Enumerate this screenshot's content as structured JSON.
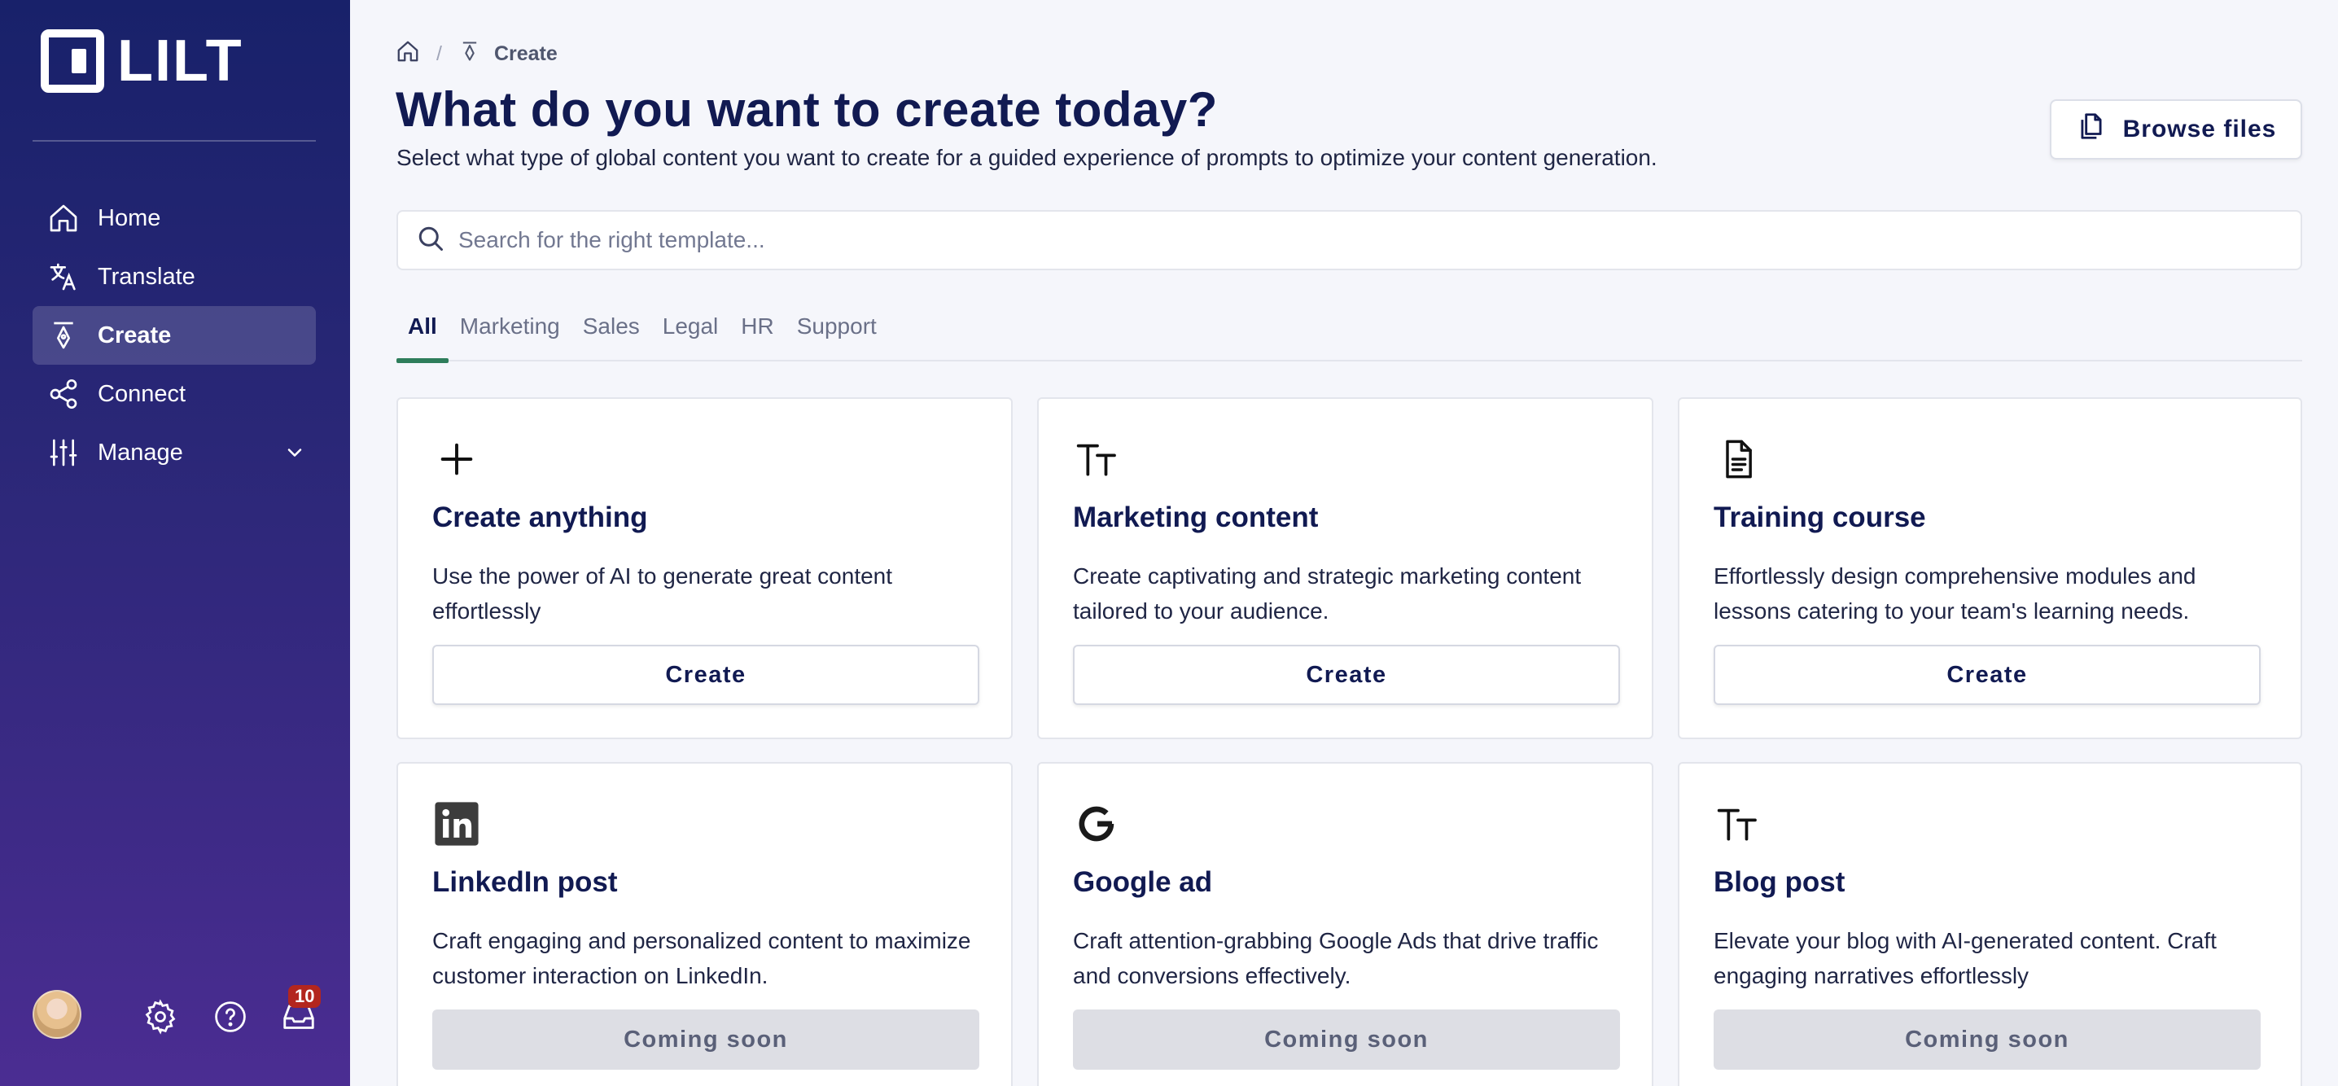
{
  "brand": {
    "name": "LILT"
  },
  "sidebar": {
    "items": [
      {
        "label": "Home",
        "icon": "home-icon",
        "active": false
      },
      {
        "label": "Translate",
        "icon": "translate-icon",
        "active": false
      },
      {
        "label": "Create",
        "icon": "pen-nib-icon",
        "active": true
      },
      {
        "label": "Connect",
        "icon": "share-nodes-icon",
        "active": false
      },
      {
        "label": "Manage",
        "icon": "sliders-icon",
        "active": false,
        "expandable": true
      }
    ],
    "notifications_count": "10"
  },
  "breadcrumb": {
    "separator": "/",
    "current": "Create"
  },
  "header": {
    "title": "What do you want to create today?",
    "subtitle": "Select what type of global content you want to create for a guided experience of prompts to optimize your content generation.",
    "browse_label": "Browse files"
  },
  "search": {
    "placeholder": "Search for the right template..."
  },
  "tabs": [
    {
      "label": "All",
      "active": true
    },
    {
      "label": "Marketing"
    },
    {
      "label": "Sales"
    },
    {
      "label": "Legal"
    },
    {
      "label": "HR"
    },
    {
      "label": "Support"
    }
  ],
  "cards": [
    {
      "title": "Create anything",
      "description": "Use the power of AI to generate great content effortlessly",
      "button": "Create",
      "icon": "plus-icon"
    },
    {
      "title": "Marketing content",
      "description": "Create captivating and strategic marketing content tailored to your audience.",
      "button": "Create",
      "icon": "text-size-icon"
    },
    {
      "title": "Training course",
      "description": "Effortlessly design comprehensive modules and lessons catering to your team's learning needs.",
      "button": "Create",
      "icon": "document-icon"
    },
    {
      "title": "LinkedIn post",
      "description": "Craft engaging and personalized content to maximize customer interaction on LinkedIn.",
      "button": "Coming soon",
      "icon": "linkedin-icon"
    },
    {
      "title": "Google ad",
      "description": "Craft attention-grabbing Google Ads that drive traffic and conversions effectively.",
      "button": "Coming soon",
      "icon": "google-icon"
    },
    {
      "title": "Blog post",
      "description": "Elevate your blog with AI-generated content. Craft engaging narratives effortlessly",
      "button": "Coming soon",
      "icon": "text-size-icon"
    }
  ],
  "colors": {
    "sidebar_top": "#18216a",
    "sidebar_bottom": "#4b2d92",
    "accent_tab": "#2e7d5b",
    "badge": "#b3261e"
  }
}
